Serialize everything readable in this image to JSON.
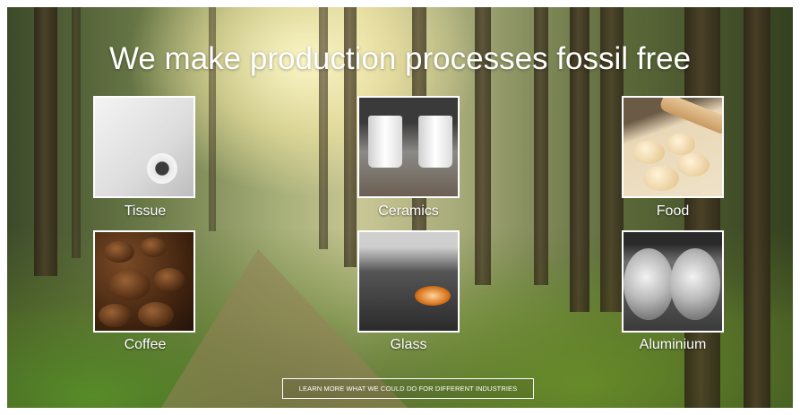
{
  "hero": {
    "headline": "We make production processes fossil free",
    "cta_label": "LEARN MORE WHAT WE COULD DO FOR DIFFERENT INDUSTRIES"
  },
  "industries": [
    {
      "label": "Tissue",
      "icon": "tissue-roll-image"
    },
    {
      "label": "Ceramics",
      "icon": "ceramic-cups-image"
    },
    {
      "label": "Food",
      "icon": "dough-image"
    },
    {
      "label": "Coffee",
      "icon": "coffee-beans-image"
    },
    {
      "label": "Glass",
      "icon": "glassblowing-image"
    },
    {
      "label": "Aluminium",
      "icon": "aluminium-rods-image"
    }
  ],
  "colors": {
    "text": "#ffffff",
    "tile_border": "#ffffff"
  }
}
